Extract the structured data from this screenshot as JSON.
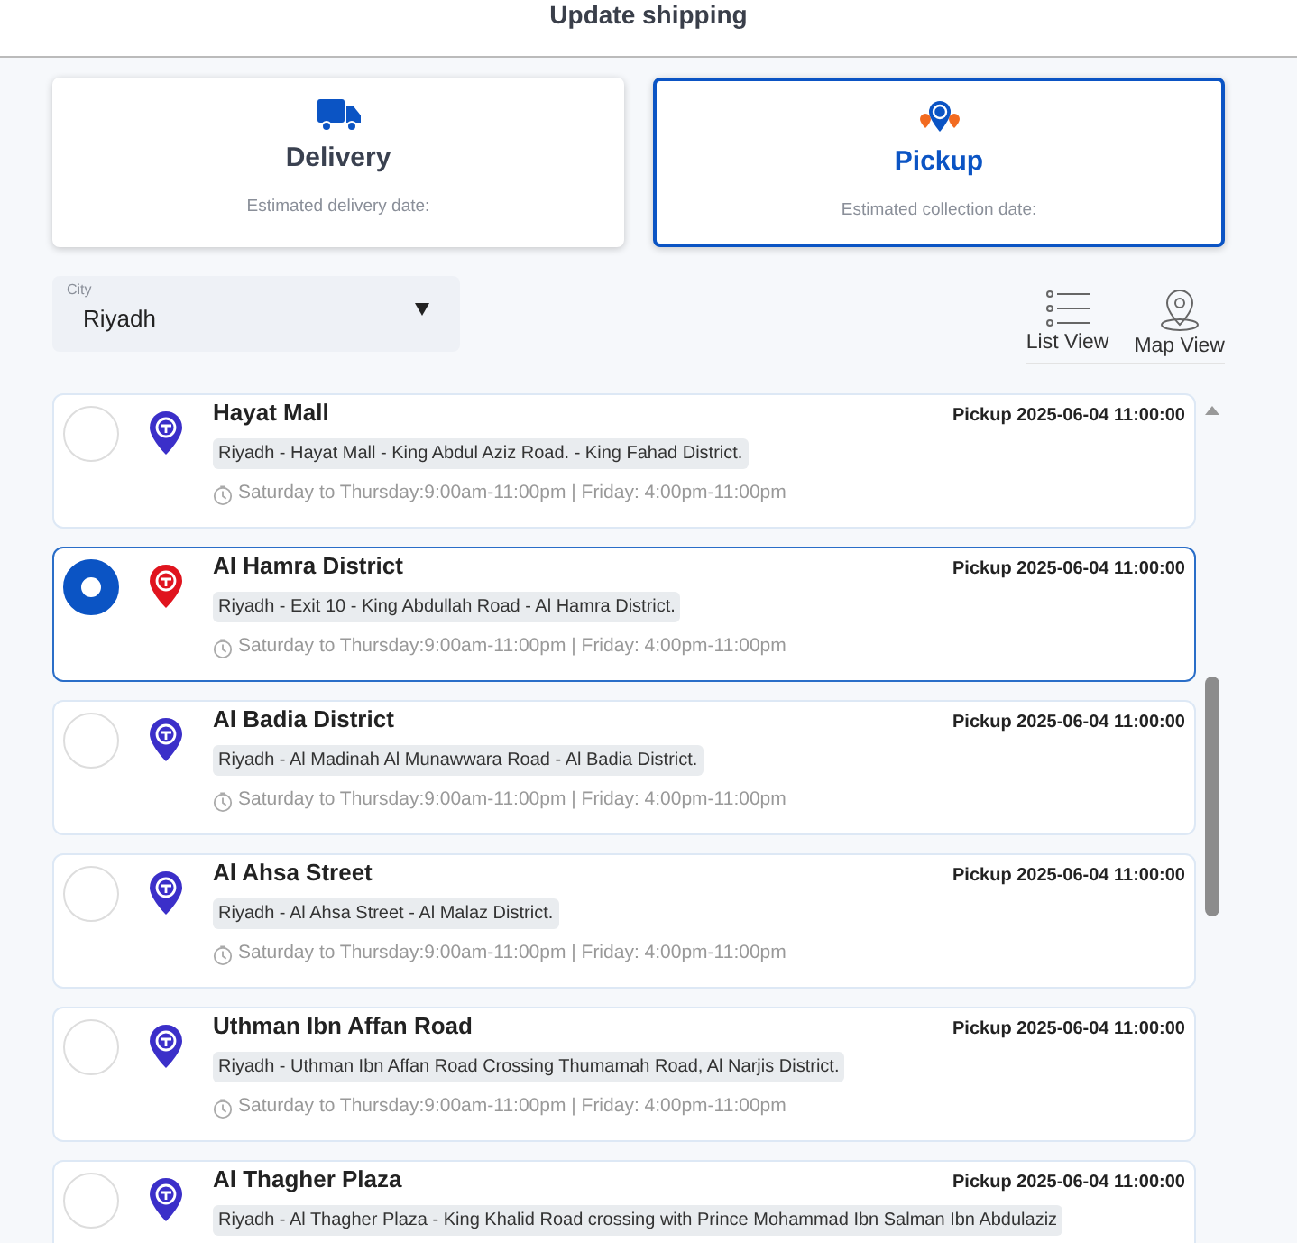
{
  "header": {
    "title": "Update shipping"
  },
  "shipping_options": [
    {
      "kind": "delivery",
      "label": "Delivery",
      "note": "Estimated delivery date:",
      "selected": false
    },
    {
      "kind": "pickup",
      "label": "Pickup",
      "note": "Estimated collection date:",
      "selected": true
    }
  ],
  "city": {
    "label": "City",
    "value": "Riyadh"
  },
  "views": [
    {
      "kind": "list",
      "label": "List View"
    },
    {
      "kind": "map",
      "label": "Map View"
    }
  ],
  "locations": [
    {
      "name": "Hayat Mall",
      "pickup": "Pickup 2025-06-04 11:00:00",
      "address": "Riyadh - Hayat Mall - King Abdul Aziz Road. - King Fahad District.",
      "hours": "Saturday to Thursday:9:00am-11:00pm | Friday: 4:00pm-11:00pm",
      "selected": false
    },
    {
      "name": "Al Hamra District",
      "pickup": "Pickup 2025-06-04 11:00:00",
      "address": "Riyadh - Exit 10 - King Abdullah Road - Al Hamra District.",
      "hours": "Saturday to Thursday:9:00am-11:00pm | Friday: 4:00pm-11:00pm",
      "selected": true
    },
    {
      "name": "Al Badia District",
      "pickup": "Pickup 2025-06-04 11:00:00",
      "address": "Riyadh - Al Madinah Al Munawwara Road - Al Badia District.",
      "hours": "Saturday to Thursday:9:00am-11:00pm | Friday: 4:00pm-11:00pm",
      "selected": false
    },
    {
      "name": "Al Ahsa Street",
      "pickup": "Pickup 2025-06-04 11:00:00",
      "address": "Riyadh - Al Ahsa Street - Al Malaz District.",
      "hours": "Saturday to Thursday:9:00am-11:00pm | Friday: 4:00pm-11:00pm",
      "selected": false
    },
    {
      "name": "Uthman Ibn Affan Road",
      "pickup": "Pickup 2025-06-04 11:00:00",
      "address": "Riyadh - Uthman Ibn Affan Road Crossing Thumamah Road, Al Narjis District.",
      "hours": "Saturday to Thursday:9:00am-11:00pm | Friday: 4:00pm-11:00pm",
      "selected": false
    },
    {
      "name": "Al Thagher Plaza",
      "pickup": "Pickup 2025-06-04 11:00:00",
      "address": "Riyadh - Al Thagher Plaza - King Khalid Road crossing with Prince Mohammad Ibn Salman Ibn Abdulaziz",
      "selected": false
    }
  ]
}
